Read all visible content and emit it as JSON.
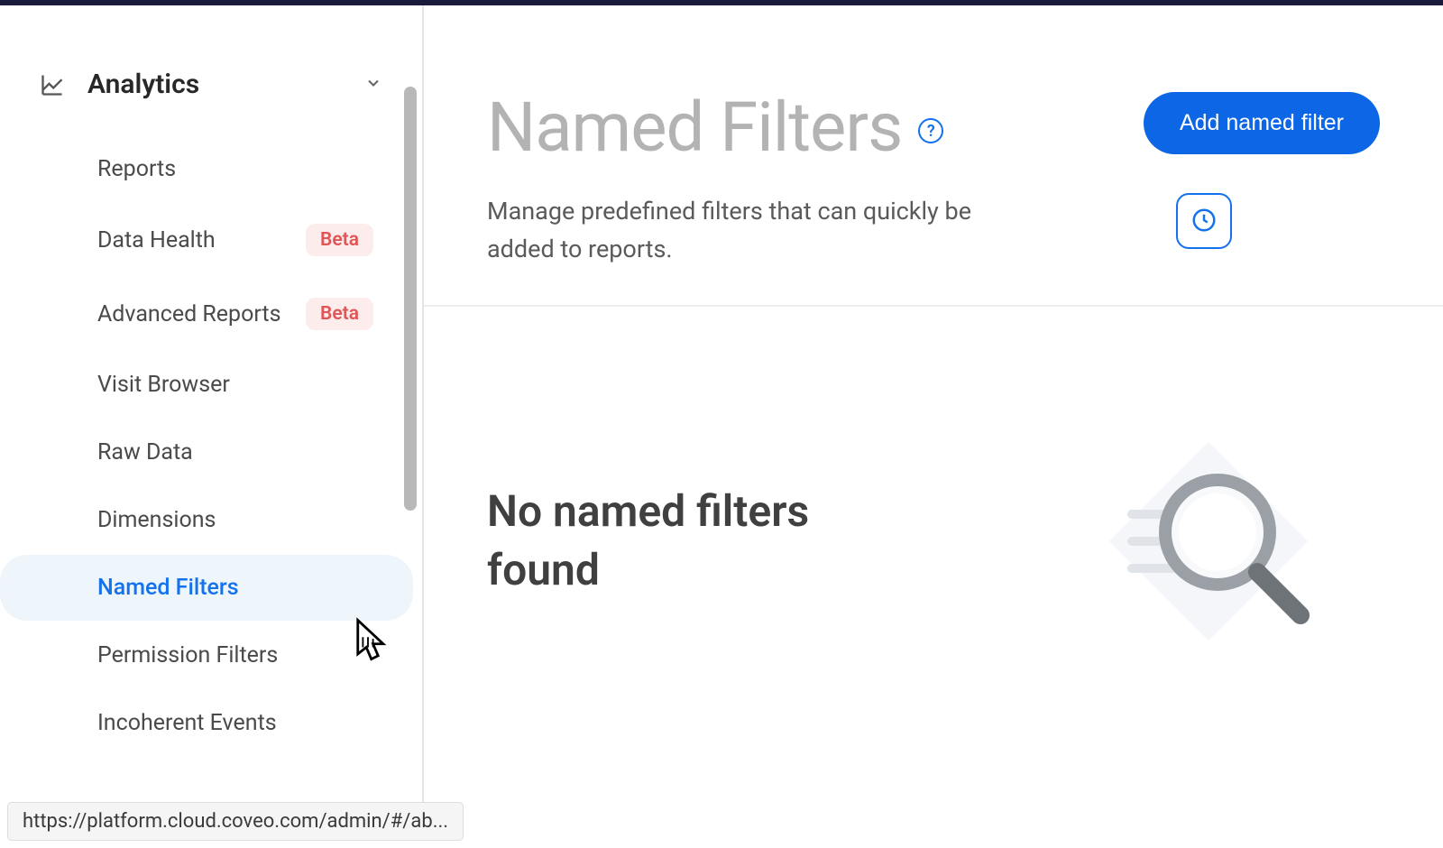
{
  "sidebar": {
    "title": "Analytics",
    "items": [
      {
        "label": "Reports",
        "badge": null,
        "active": false
      },
      {
        "label": "Data Health",
        "badge": "Beta",
        "active": false
      },
      {
        "label": "Advanced Reports",
        "badge": "Beta",
        "active": false
      },
      {
        "label": "Visit Browser",
        "badge": null,
        "active": false
      },
      {
        "label": "Raw Data",
        "badge": null,
        "active": false
      },
      {
        "label": "Dimensions",
        "badge": null,
        "active": false
      },
      {
        "label": "Named Filters",
        "badge": null,
        "active": true
      },
      {
        "label": "Permission Filters",
        "badge": null,
        "active": false
      },
      {
        "label": "Incoherent Events",
        "badge": null,
        "active": false
      }
    ]
  },
  "page": {
    "title": "Named Filters",
    "description": "Manage predefined filters that can quickly be added to reports.",
    "add_button_label": "Add named filter",
    "help_symbol": "?"
  },
  "empty_state": {
    "title": "No named filters found"
  },
  "status_bar": {
    "url": "https://platform.cloud.coveo.com/admin/#/ab..."
  }
}
